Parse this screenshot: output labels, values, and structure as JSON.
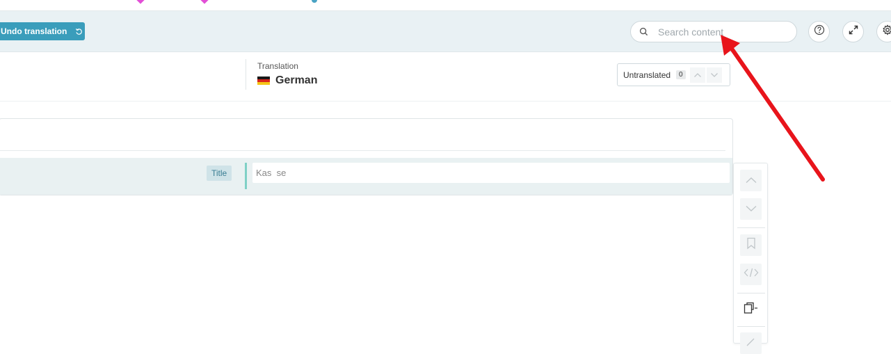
{
  "toolbar": {
    "undo_label": "Undo translation",
    "search_placeholder": "Search content"
  },
  "header": {
    "translation_label": "Translation",
    "language": "German",
    "filter_label": "Untranslated",
    "filter_count": "0"
  },
  "segment": {
    "tag": "Title",
    "value": "Kas  se"
  },
  "icons": [
    "undo-icon",
    "search-icon",
    "help-icon",
    "expand-icon",
    "gear-icon",
    "flag-de-icon",
    "chevron-up-icon",
    "chevron-down-icon",
    "bookmark-icon",
    "code-icon",
    "copy-icon",
    "pen-icon"
  ],
  "colors": {
    "accent": "#3a9dbb",
    "annotation_arrow": "#e8141b"
  }
}
